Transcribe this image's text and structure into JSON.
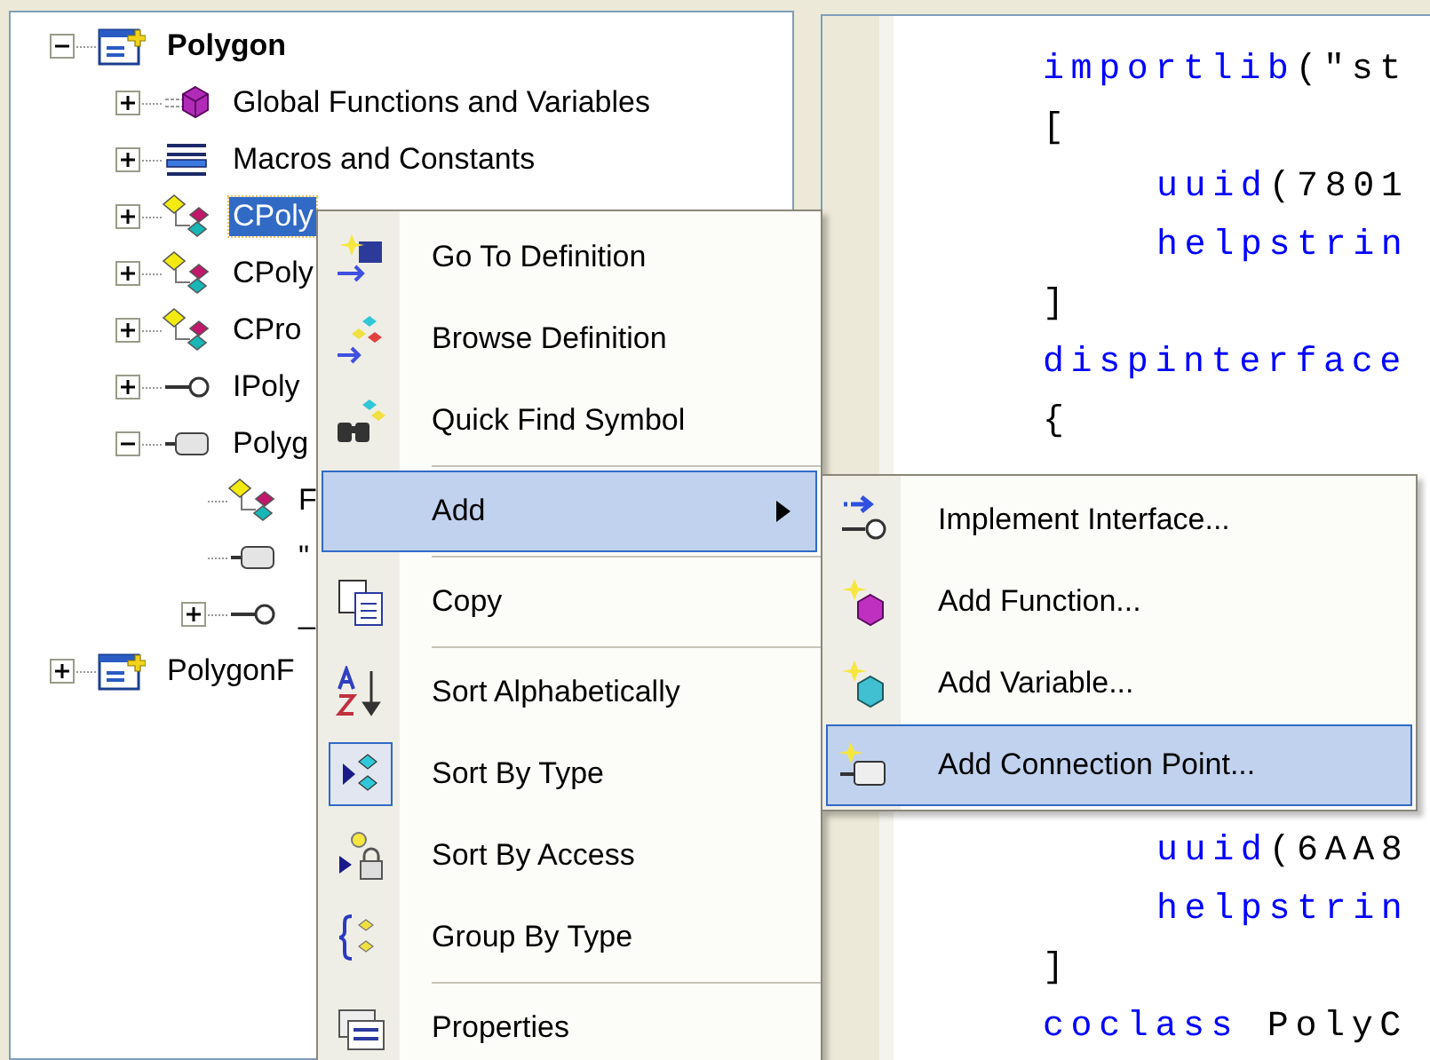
{
  "tree": {
    "items": [
      {
        "label": "Polygon",
        "kind": "project",
        "startup": true,
        "expanded": true,
        "selected": false,
        "children": [
          {
            "label": "Global Functions and Variables",
            "kind": "globals",
            "expanded": false,
            "selected": false
          },
          {
            "label": "Macros and Constants",
            "kind": "macros",
            "expanded": false,
            "selected": false
          },
          {
            "label": "CPoly",
            "kind": "class",
            "expanded": false,
            "selected": true
          },
          {
            "label": "CPoly",
            "kind": "class",
            "expanded": false,
            "selected": false
          },
          {
            "label": "CPro",
            "kind": "class",
            "expanded": false,
            "selected": false
          },
          {
            "label": "IPoly",
            "kind": "interface",
            "expanded": false,
            "selected": false
          },
          {
            "label": "Polyg",
            "kind": "library",
            "expanded": true,
            "selected": false,
            "children": [
              {
                "label": "F",
                "kind": "class",
                "selected": false
              },
              {
                "label": "\"",
                "kind": "library",
                "selected": false
              },
              {
                "label": "_",
                "kind": "interface",
                "expanded": false,
                "selected": false
              }
            ]
          }
        ]
      },
      {
        "label": "PolygonF",
        "kind": "project",
        "startup": false,
        "expanded": false,
        "selected": false
      }
    ]
  },
  "context_menu": {
    "items": [
      {
        "kind": "item",
        "label": "Go To Definition",
        "selected": false,
        "checked": false
      },
      {
        "kind": "item",
        "label": "Browse Definition",
        "selected": false,
        "checked": false
      },
      {
        "kind": "item",
        "label": "Quick Find Symbol",
        "selected": false,
        "checked": false
      },
      {
        "kind": "separator"
      },
      {
        "kind": "submenu",
        "label": "Add",
        "selected": true
      },
      {
        "kind": "separator"
      },
      {
        "kind": "item",
        "label": "Copy",
        "selected": false,
        "checked": false
      },
      {
        "kind": "separator"
      },
      {
        "kind": "item",
        "label": "Sort Alphabetically",
        "selected": false,
        "checked": false
      },
      {
        "kind": "item",
        "label": "Sort By Type",
        "selected": false,
        "checked": true
      },
      {
        "kind": "item",
        "label": "Sort By Access",
        "selected": false,
        "checked": false
      },
      {
        "kind": "item",
        "label": "Group By Type",
        "selected": false,
        "checked": false
      },
      {
        "kind": "separator"
      },
      {
        "kind": "item",
        "label": "Properties",
        "selected": false,
        "checked": false
      }
    ]
  },
  "submenu": {
    "items": [
      {
        "label": "Implement Interface...",
        "selected": false
      },
      {
        "label": "Add Function...",
        "selected": false
      },
      {
        "label": "Add Variable...",
        "selected": false
      },
      {
        "label": "Add Connection Point...",
        "selected": true
      }
    ]
  },
  "code": {
    "lines_top": [
      {
        "kind": "outer",
        "tokens": [
          {
            "kind": "keyword",
            "text": "importlib"
          },
          {
            "kind": "plain",
            "text": "(\"st"
          }
        ]
      },
      {
        "kind": "outer",
        "tokens": [
          {
            "kind": "plain",
            "text": "["
          }
        ]
      },
      {
        "kind": "inner",
        "tokens": [
          {
            "kind": "keyword",
            "text": "uuid"
          },
          {
            "kind": "plain",
            "text": "(7801"
          }
        ]
      },
      {
        "kind": "inner",
        "tokens": [
          {
            "kind": "keyword",
            "text": "helpstrin"
          }
        ]
      },
      {
        "kind": "outer",
        "tokens": [
          {
            "kind": "plain",
            "text": "]"
          }
        ]
      },
      {
        "kind": "outer",
        "tokens": [
          {
            "kind": "keyword",
            "text": "dispinterface"
          }
        ]
      },
      {
        "kind": "outer",
        "tokens": [
          {
            "kind": "plain",
            "text": "{"
          }
        ]
      }
    ],
    "lines_bottom": [
      {
        "kind": "inner",
        "tokens": [
          {
            "kind": "keyword",
            "text": "uuid"
          },
          {
            "kind": "plain",
            "text": "(6AA8"
          }
        ]
      },
      {
        "kind": "inner",
        "tokens": [
          {
            "kind": "keyword",
            "text": "helpstrin"
          }
        ]
      },
      {
        "kind": "outer",
        "tokens": [
          {
            "kind": "plain",
            "text": "]"
          }
        ]
      },
      {
        "kind": "outer",
        "tokens": [
          {
            "kind": "keyword",
            "text": "coclass"
          },
          {
            "kind": "plain",
            "text": " PolyC"
          }
        ]
      }
    ]
  }
}
